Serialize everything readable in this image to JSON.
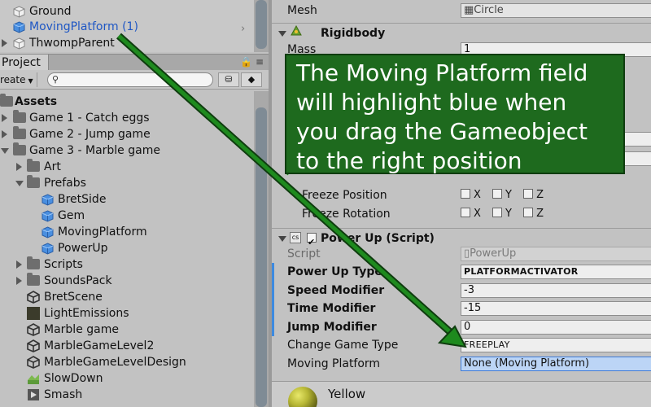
{
  "hierarchy": {
    "items": [
      {
        "label": "Ground",
        "selected": false
      },
      {
        "label": "MovingPlatform (1)",
        "selected": true
      },
      {
        "label": "ThwompParent",
        "selected": false
      }
    ]
  },
  "project": {
    "tab_label": "Project",
    "create_label": "reate",
    "search_placeholder": "",
    "tree": [
      {
        "label": "Assets",
        "bold": true
      },
      {
        "label": "Game 1 - Catch eggs"
      },
      {
        "label": "Game 2 - Jump game"
      },
      {
        "label": "Game 3 - Marble game"
      },
      {
        "label": "Art"
      },
      {
        "label": "Prefabs"
      },
      {
        "label": "BretSide"
      },
      {
        "label": "Gem"
      },
      {
        "label": "MovingPlatform"
      },
      {
        "label": "PowerUp"
      },
      {
        "label": "Scripts"
      },
      {
        "label": "SoundsPack"
      },
      {
        "label": "BretScene"
      },
      {
        "label": "LightEmissions"
      },
      {
        "label": "Marble game"
      },
      {
        "label": "MarbleGameLevel2"
      },
      {
        "label": "MarbleGameLevelDesign"
      },
      {
        "label": "SlowDown"
      },
      {
        "label": "Smash"
      }
    ]
  },
  "inspector": {
    "mesh_label": "Mesh",
    "mesh_value": "Circle",
    "rigidbody_title": "Rigidbody",
    "mass_label": "Mass",
    "mass_value": "1",
    "freeze_position_label": "Freeze Position",
    "freeze_rotation_label": "Freeze Rotation",
    "axes": [
      "X",
      "Y",
      "Z"
    ],
    "powerup_title": "Power Up (Script)",
    "script_label": "Script",
    "script_value": "PowerUp",
    "fields": [
      {
        "label": "Power Up Type",
        "value": "PLATFORMACTIVATOR",
        "bold": true
      },
      {
        "label": "Speed Modifier",
        "value": "-3",
        "bold": true
      },
      {
        "label": "Time Modifier",
        "value": "-15",
        "bold": true
      },
      {
        "label": "Jump Modifier",
        "value": "0",
        "bold": true
      },
      {
        "label": "Change Game Type",
        "value": "FREEPLAY",
        "bold": false
      },
      {
        "label": "Moving Platform",
        "value": "None (Moving Platform)",
        "bold": false
      }
    ],
    "material_name": "Yellow"
  },
  "callout": {
    "text": "The Moving Platform field will highlight blue when you drag the Gameobject to the right position"
  },
  "colors": {
    "callout_bg": "#1e6a1e",
    "selected_text": "#1f57c4",
    "highlight_field": "#bcd5f6"
  }
}
